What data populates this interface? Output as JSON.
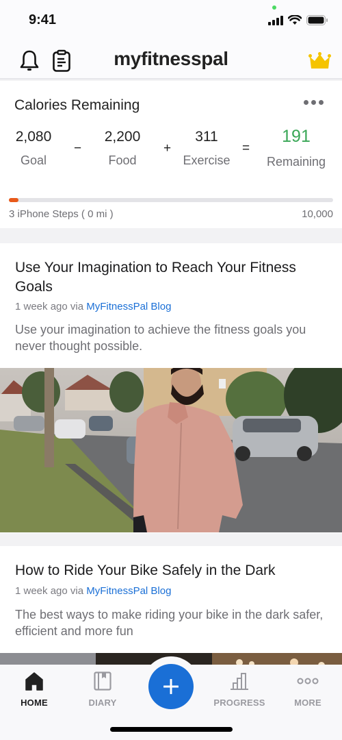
{
  "status_bar": {
    "time": "9:41"
  },
  "header": {
    "title": "myfitnesspal",
    "icons": [
      "bell-icon",
      "clipboard-icon",
      "crown-icon"
    ],
    "crown_color": "#f5c400"
  },
  "calories": {
    "title": "Calories Remaining",
    "goal": {
      "value": "2,080",
      "label": "Goal"
    },
    "food": {
      "value": "2,200",
      "label": "Food"
    },
    "exercise": {
      "value": "311",
      "label": "Exercise"
    },
    "remaining": {
      "value": "191",
      "label": "Remaining"
    },
    "operators": {
      "minus": "−",
      "plus": "+",
      "equals": "="
    },
    "remaining_color": "#3aa757",
    "steps": {
      "label": "3 iPhone Steps",
      "distance": "( 0 mi )",
      "goal": "10,000",
      "progress_fraction": 0.0003,
      "fill_color": "#e8591a"
    }
  },
  "articles": [
    {
      "title": "Use Your Imagination to Reach Your Fitness Goals",
      "time_ago": "1 week ago via ",
      "source": "MyFitnessPal Blog",
      "description": "Use your imagination to achieve the fitness goals you never thought possible."
    },
    {
      "title": "How to Ride Your Bike Safely in the Dark",
      "time_ago": "1 week ago via ",
      "source": "MyFitnessPal Blog",
      "description": "The best ways to make riding your bike in the dark safer, efficient and more fun"
    }
  ],
  "tab_bar": {
    "tabs": [
      {
        "label": "HOME",
        "icon": "home-icon",
        "active": true
      },
      {
        "label": "DIARY",
        "icon": "book-icon",
        "active": false
      },
      {
        "label": "PROGRESS",
        "icon": "bar-chart-icon",
        "active": false
      },
      {
        "label": "MORE",
        "icon": "more-dots-icon",
        "active": false
      }
    ],
    "fab_icon": "plus-icon",
    "accent": "#1a6fd6"
  }
}
